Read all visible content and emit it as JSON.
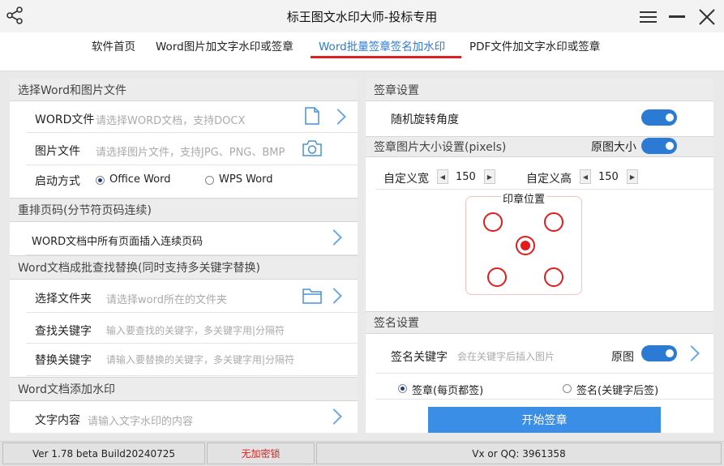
{
  "window": {
    "title": "标王图文水印大师-投标专用"
  },
  "tabs": [
    {
      "label": "软件首页"
    },
    {
      "label": "Word图片加文字水印或签章"
    },
    {
      "label": "Word批量签章签名加水印"
    },
    {
      "label": "PDF文件加文字水印或签章"
    }
  ],
  "left": {
    "section1": {
      "title": "选择Word和图片文件",
      "word_label": "WORD文件",
      "word_placeholder": "请选择WORD文档，支持DOCX",
      "image_label": "图片文件",
      "image_placeholder": "请选择图片文件，支持JPG、PNG、BMP",
      "launch_label": "启动方式",
      "launch_options": [
        "Office Word",
        "WPS Word"
      ],
      "launch_selected": "Office Word"
    },
    "section2": {
      "title": "重排页码(分节符页码连续)",
      "item": "WORD文档中所有页面插入连续页码"
    },
    "section3": {
      "title": "Word文档成批查找替换(同时支持多关键字替换)",
      "folder_label": "选择文件夹",
      "folder_placeholder": "请选择word所在的文件夹",
      "find_label": "查找关键字",
      "find_placeholder": "输入要查找的关键字，多关键字用|分隔符",
      "replace_label": "替换关键字",
      "replace_placeholder": "请输入要替换的关键字，多关键字用|分隔符"
    },
    "section4": {
      "title": "Word文档添加水印",
      "text_label": "文字内容",
      "text_placeholder": "请输入文字水印的内容"
    }
  },
  "right": {
    "stamp": {
      "title": "签章设置",
      "rotate_label": "随机旋转角度",
      "rotate_on": true,
      "size_title": "签章图片大小设置(pixels)",
      "original_size_label": "原图大小",
      "original_size_on": true,
      "width_label": "自定义宽",
      "width_value": "150",
      "height_label": "自定义高",
      "height_value": "150",
      "position_title": "印章位置",
      "position_selected": "center"
    },
    "sign": {
      "title": "签名设置",
      "keyword_label": "签名关键字",
      "keyword_placeholder": "会在关键字后插入图片",
      "original_label": "原图",
      "original_on": true,
      "mode_options": [
        "签章(每页都签)",
        "签名(关键字后签)"
      ],
      "mode_selected": "签章(每页都签)",
      "start_button": "开始签章"
    }
  },
  "status": {
    "version": "Ver 1.78 beta Build20240725",
    "lock": "无加密锁",
    "contact": "Vx or QQ: 3961358"
  },
  "colors": {
    "accent": "#2b7bd5",
    "tab_underline": "#e02020",
    "stamp_red": "#e41b1b",
    "lock_text": "#e02020"
  },
  "icons": [
    "share-icon",
    "menu-icon",
    "minimize-icon",
    "close-icon",
    "file-icon",
    "camera-icon",
    "folder-icon",
    "chevron-right-icon"
  ]
}
